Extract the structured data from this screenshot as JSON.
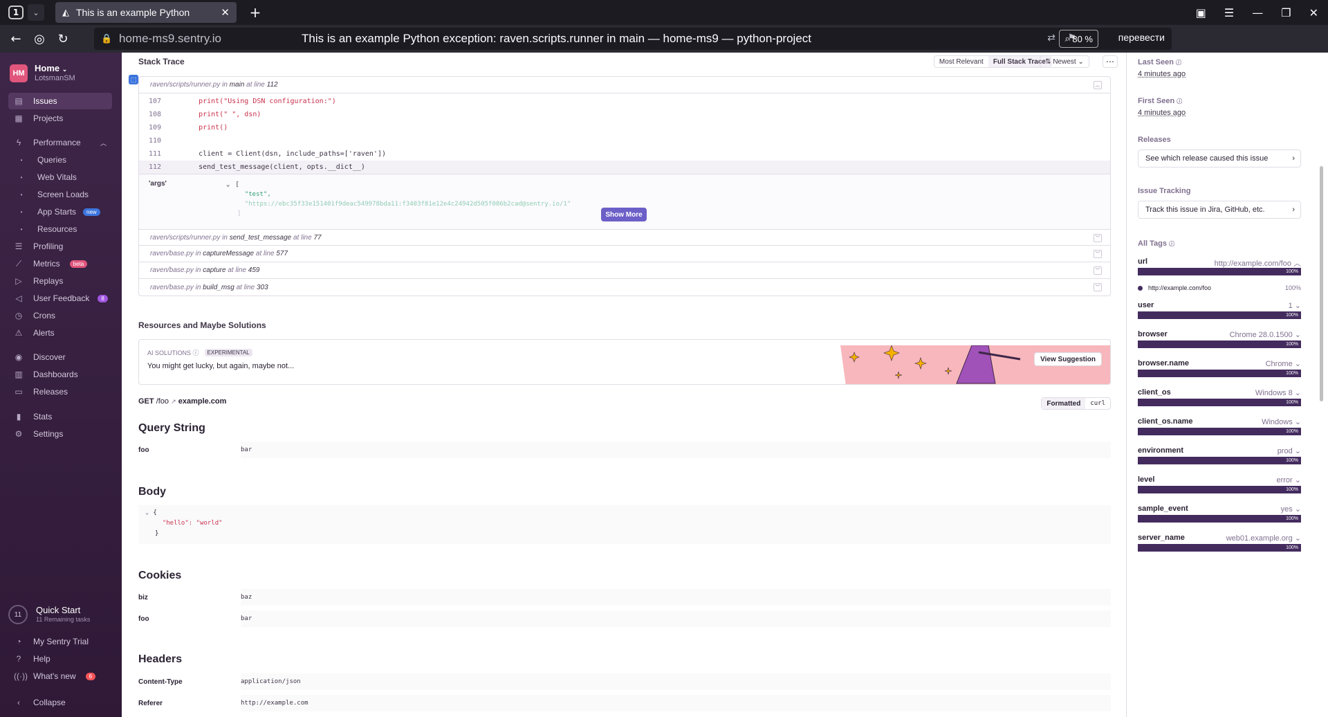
{
  "browser": {
    "tab_count": "1",
    "tab_title": "This is an example Python",
    "url_domain": "home-ms9.sentry.io",
    "page_title": "This is an example Python exception: raven.scripts.runner in main — home-ms9 — python-project",
    "zoom": "80 %",
    "translate": "перевести"
  },
  "sidebar": {
    "org_initials": "HM",
    "org_name": "Home",
    "org_user": "LotsmanSM",
    "items": [
      {
        "label": "Issues"
      },
      {
        "label": "Projects"
      },
      {
        "label": "Performance"
      },
      {
        "label": "Queries"
      },
      {
        "label": "Web Vitals"
      },
      {
        "label": "Screen Loads"
      },
      {
        "label": "App Starts",
        "badge": "new"
      },
      {
        "label": "Resources"
      },
      {
        "label": "Profiling"
      },
      {
        "label": "Metrics",
        "badge": "beta"
      },
      {
        "label": "Replays"
      },
      {
        "label": "User Feedback",
        "badge": "8"
      },
      {
        "label": "Crons"
      },
      {
        "label": "Alerts"
      },
      {
        "label": "Discover"
      },
      {
        "label": "Dashboards"
      },
      {
        "label": "Releases"
      },
      {
        "label": "Stats"
      },
      {
        "label": "Settings"
      }
    ],
    "quickstart": {
      "count": "11",
      "title": "Quick Start",
      "sub": "11 Remaining tasks"
    },
    "bottom": [
      {
        "label": "My Sentry Trial"
      },
      {
        "label": "Help"
      },
      {
        "label": "What's new",
        "badge": "6"
      },
      {
        "label": "Collapse"
      }
    ]
  },
  "stack": {
    "title": "Stack Trace",
    "btn_most_relevant": "Most Relevant",
    "btn_full": "Full Stack Trace",
    "btn_newest": "Newest",
    "frame1": {
      "file": "raven/scripts/runner.py",
      "in": "in",
      "func": "main",
      "at": "at line",
      "line": "112"
    },
    "code": [
      {
        "n": "107",
        "t": "    print(\"Using DSN configuration:\")"
      },
      {
        "n": "108",
        "t": "    print(\" \", dsn)"
      },
      {
        "n": "109",
        "t": "    print()"
      },
      {
        "n": "110",
        "t": ""
      },
      {
        "n": "111",
        "t": "    client = Client(dsn, include_paths=['raven'])"
      },
      {
        "n": "112",
        "t": "    send_test_message(client, opts.__dict__)"
      }
    ],
    "args_key": "'args'",
    "args_lines": [
      "[",
      "  \"test\",",
      "  \"https://ebc35f33e151401f9deac549978bda11:f3403f81e12e4c24942d505f086b2cad@sentry.io/1\"",
      "]"
    ],
    "show_more": "Show More",
    "frames": [
      {
        "file": "raven/scripts/runner.py",
        "func": "send_test_message",
        "line": "77"
      },
      {
        "file": "raven/base.py",
        "func": "captureMessage",
        "line": "577"
      },
      {
        "file": "raven/base.py",
        "func": "capture",
        "line": "459"
      },
      {
        "file": "raven/base.py",
        "func": "build_msg",
        "line": "303"
      }
    ]
  },
  "solutions": {
    "title": "Resources and Maybe Solutions",
    "ai_label": "AI SOLUTIONS",
    "experimental": "EXPERIMENTAL",
    "text": "You might get lucky, but again, maybe not...",
    "view": "View Suggestion"
  },
  "request": {
    "method": "GET",
    "path": "/foo",
    "host": "example.com",
    "formatted": "Formatted",
    "curl": "curl",
    "query_title": "Query String",
    "query": [
      {
        "k": "foo",
        "v": "bar"
      }
    ],
    "body_title": "Body",
    "body_lines": [
      "{",
      "  \"hello\": \"world\"",
      "}"
    ],
    "cookies_title": "Cookies",
    "cookies": [
      {
        "k": "biz",
        "v": "baz"
      },
      {
        "k": "foo",
        "v": "bar"
      }
    ],
    "headers_title": "Headers",
    "headers": [
      {
        "k": "Content-Type",
        "v": "application/json"
      },
      {
        "k": "Referer",
        "v": "http://example.com"
      }
    ]
  },
  "right": {
    "last_seen_label": "Last Seen",
    "last_seen": "4 minutes ago",
    "first_seen_label": "First Seen",
    "first_seen": "4 minutes ago",
    "releases_label": "Releases",
    "releases_btn": "See which release caused this issue",
    "tracking_label": "Issue Tracking",
    "tracking_btn": "Track this issue in Jira, GitHub, etc.",
    "tags_label": "All Tags",
    "url_tag": {
      "k": "url",
      "v": "http://example.com/foo",
      "pct": "100%",
      "item": "http://example.com/foo",
      "item_pct": "100%"
    },
    "tags": [
      {
        "k": "user",
        "v": "1",
        "pct": "100%"
      },
      {
        "k": "browser",
        "v": "Chrome 28.0.1500",
        "pct": "100%"
      },
      {
        "k": "browser.name",
        "v": "Chrome",
        "pct": "100%"
      },
      {
        "k": "client_os",
        "v": "Windows 8",
        "pct": "100%"
      },
      {
        "k": "client_os.name",
        "v": "Windows",
        "pct": "100%"
      },
      {
        "k": "environment",
        "v": "prod",
        "pct": "100%"
      },
      {
        "k": "level",
        "v": "error",
        "pct": "100%"
      },
      {
        "k": "sample_event",
        "v": "yes",
        "pct": "100%"
      },
      {
        "k": "server_name",
        "v": "web01.example.org",
        "pct": "100%"
      }
    ]
  }
}
